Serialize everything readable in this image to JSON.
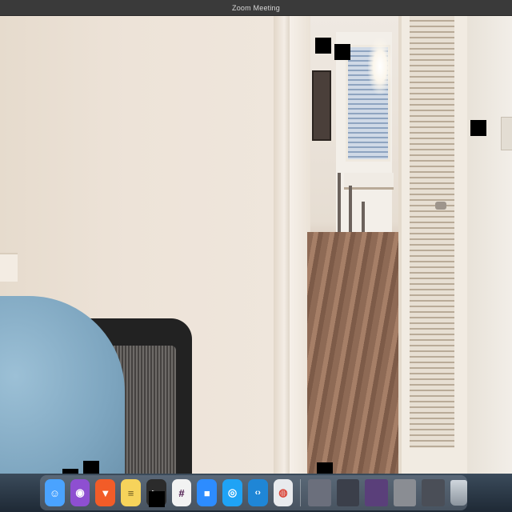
{
  "window": {
    "title": "Zoom Meeting"
  },
  "dock": {
    "apps": [
      {
        "name": "Finder",
        "icon": "finder-icon",
        "color": "#4aa3ff",
        "glyph": "☺"
      },
      {
        "name": "Podcasts",
        "icon": "podcasts-icon",
        "color": "#8e4fd1",
        "glyph": "◉"
      },
      {
        "name": "Brave",
        "icon": "brave-icon",
        "color": "#f25c28",
        "glyph": "▼"
      },
      {
        "name": "Notes",
        "icon": "notes-icon",
        "color": "#f6d35b",
        "glyph": "≡"
      },
      {
        "name": "Terminal",
        "icon": "terminal-icon",
        "color": "#2b2b2b",
        "glyph": ">_"
      },
      {
        "name": "Slack",
        "icon": "slack-icon",
        "color": "#f2f2f2",
        "glyph": "#"
      },
      {
        "name": "Zoom",
        "icon": "zoom-icon",
        "color": "#2d8cff",
        "glyph": "■"
      },
      {
        "name": "Safari",
        "icon": "safari-icon",
        "color": "#1fa3f5",
        "glyph": "◎"
      },
      {
        "name": "Visual Studio Code",
        "icon": "vscode-icon",
        "color": "#1f86d6",
        "glyph": "‹›"
      },
      {
        "name": "Chrome",
        "icon": "chrome-icon",
        "color": "#e8eaed",
        "glyph": "◍"
      }
    ],
    "recent": [
      {
        "icon": "window-thumbnail-1",
        "color": "#6b6f7c"
      },
      {
        "icon": "window-thumbnail-2",
        "color": "#3b3f4a"
      },
      {
        "icon": "window-thumbnail-3",
        "color": "#5a3f7a"
      },
      {
        "icon": "window-thumbnail-4",
        "color": "#8a8d93"
      },
      {
        "icon": "window-thumbnail-5",
        "color": "#4a4e57"
      },
      {
        "icon": "window-thumbnail-6",
        "color": "#c9ced6"
      }
    ],
    "trash_icon": "trash-icon"
  }
}
